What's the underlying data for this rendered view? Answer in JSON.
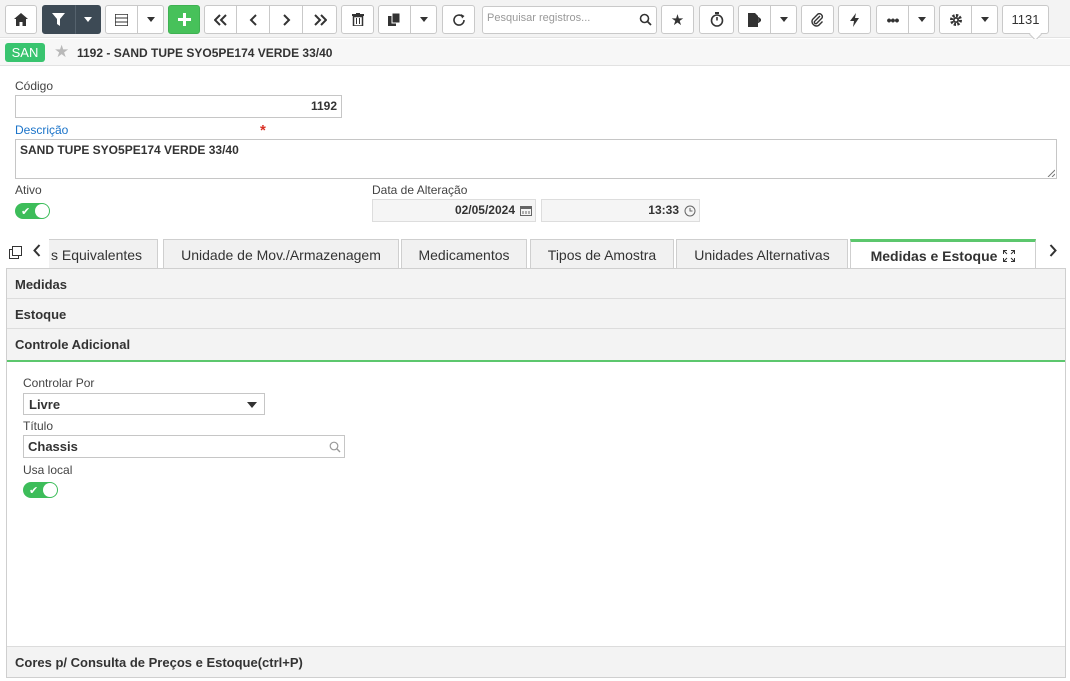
{
  "toolbar": {
    "buttons": [
      {
        "icon": "home-icon"
      },
      {
        "icon": "filter-icon"
      },
      {
        "icon": "list-icon"
      },
      {
        "icon": "add-icon"
      },
      {
        "icon": "first-icon"
      },
      {
        "icon": "prev-icon"
      },
      {
        "icon": "next-icon"
      },
      {
        "icon": "last-icon"
      },
      {
        "icon": "trash-icon"
      },
      {
        "icon": "copy-icon"
      },
      {
        "icon": "refresh-icon"
      },
      {
        "icon": "star-icon"
      },
      {
        "icon": "timer-icon"
      },
      {
        "icon": "export-icon"
      },
      {
        "icon": "attach-icon"
      },
      {
        "icon": "bolt-icon"
      },
      {
        "icon": "more-icon"
      },
      {
        "icon": "gear-icon"
      }
    ],
    "search_placeholder": "Pesquisar registros...",
    "record_count": "1131"
  },
  "header": {
    "badge": "SAN",
    "title": "1192 - SAND TUPE SYO5PE174 VERDE 33/40"
  },
  "form": {
    "codigo_label": "Código",
    "codigo_value": "1192",
    "descricao_label": "Descrição",
    "required_mark": "*",
    "descricao_value": "SAND TUPE SYO5PE174 VERDE 33/40",
    "ativo_label": "Ativo",
    "ativo_on": true,
    "data_label": "Data de Alteração",
    "data_value": "02/05/2024",
    "hora_value": "13:33"
  },
  "tabs": [
    {
      "label": "s Equivalentes"
    },
    {
      "label": "Unidade de Mov./Armazenagem"
    },
    {
      "label": "Medicamentos"
    },
    {
      "label": "Tipos de Amostra"
    },
    {
      "label": "Unidades Alternativas"
    },
    {
      "label": "Medidas e Estoque",
      "active": true
    }
  ],
  "sections": {
    "medidas": "Medidas",
    "estoque": "Estoque",
    "controle": "Controle Adicional",
    "cores": "Cores p/ Consulta de Preços e Estoque(ctrl+P)"
  },
  "controle": {
    "controlar_label": "Controlar Por",
    "controlar_value": "Livre",
    "titulo_label": "Título",
    "titulo_value": "Chassis",
    "usa_local_label": "Usa local",
    "usa_local_on": true
  },
  "colors": {
    "accent_green": "#47c15a",
    "dark_button": "#3d4a55",
    "label_blue": "#1a73c9",
    "required_red": "#d93025"
  }
}
